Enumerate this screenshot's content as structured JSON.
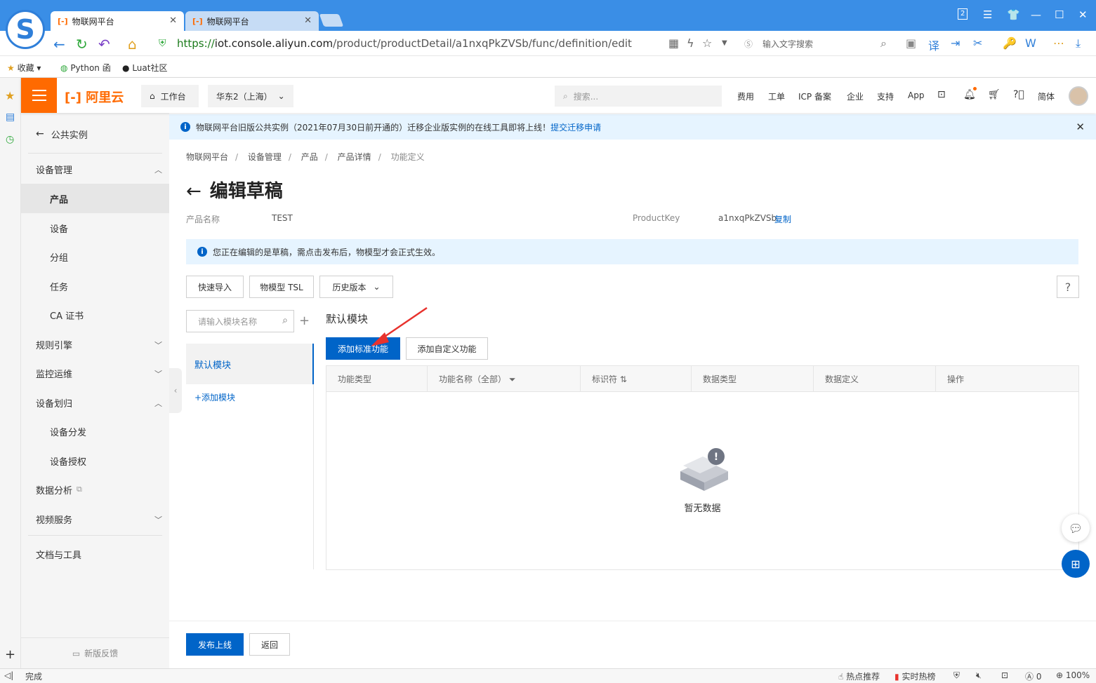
{
  "browser": {
    "tabs": [
      {
        "icon": "[-]",
        "title": "物联网平台",
        "active": true
      },
      {
        "icon": "[-]",
        "title": "物联网平台",
        "active": false
      }
    ],
    "url_scheme": "https://",
    "url_domain": "iot.console.aliyun.com",
    "url_path": "/product/productDetail/a1nxqPkZVSb/func/definition/edit",
    "search_placeholder": "输入文字搜索",
    "tab_count": "2",
    "bookmarks": [
      "收藏",
      "Python 函",
      "Luat社区"
    ]
  },
  "topnav": {
    "logo": "阿里云",
    "workbench": "工作台",
    "region": "华东2（上海）",
    "search_placeholder": "搜索...",
    "links": [
      "费用",
      "工单",
      "ICP 备案",
      "企业",
      "支持",
      "App"
    ],
    "lang": "简体"
  },
  "sidenav": {
    "back": "公共实例",
    "groups": [
      {
        "label": "设备管理"
      },
      {
        "label": "产品"
      },
      {
        "label": "设备"
      },
      {
        "label": "分组"
      },
      {
        "label": "任务"
      },
      {
        "label": "CA 证书"
      },
      {
        "label": "规则引擎"
      },
      {
        "label": "监控运维"
      },
      {
        "label": "设备划归"
      },
      {
        "label": "设备分发"
      },
      {
        "label": "设备授权"
      },
      {
        "label": "数据分析"
      },
      {
        "label": "视频服务"
      },
      {
        "label": "文档与工具"
      }
    ],
    "feedback": "新版反馈"
  },
  "notice": {
    "text": "物联网平台旧版公共实例（2021年07月30日前开通的）迁移企业版实例的在线工具即将上线！",
    "link": "提交迁移申请"
  },
  "breadcrumb": [
    "物联网平台",
    "设备管理",
    "产品",
    "产品详情",
    "功能定义"
  ],
  "page": {
    "title": "编辑草稿",
    "product_name_label": "产品名称",
    "product_name": "TEST",
    "product_key_label": "ProductKey",
    "product_key": "a1nxqPkZVSb",
    "copy": "复制",
    "draft_tip": "您正在编辑的是草稿，需点击发布后，物模型才会正式生效。"
  },
  "toolbar": {
    "quick_import": "快速导入",
    "tsl": "物模型 TSL",
    "history": "历史版本",
    "help": "?"
  },
  "modules": {
    "search_placeholder": "请输入模块名称",
    "active": "默认模块",
    "add": "+添加模块"
  },
  "section": {
    "title": "默认模块",
    "add_standard": "添加标准功能",
    "add_custom": "添加自定义功能",
    "columns": [
      "功能类型",
      "功能名称（全部）",
      "标识符",
      "数据类型",
      "数据定义",
      "操作"
    ],
    "empty": "暂无数据"
  },
  "footer": {
    "publish": "发布上线",
    "back": "返回"
  },
  "status": {
    "left": "完成",
    "hot": "热点推荐",
    "realtime": "实时热榜",
    "count": "0",
    "zoom": "100%"
  },
  "colors": {
    "brand": "#ff6a00",
    "primary": "#0064c8",
    "chrome": "#3a8ee6",
    "annotation": "#e8322d"
  }
}
